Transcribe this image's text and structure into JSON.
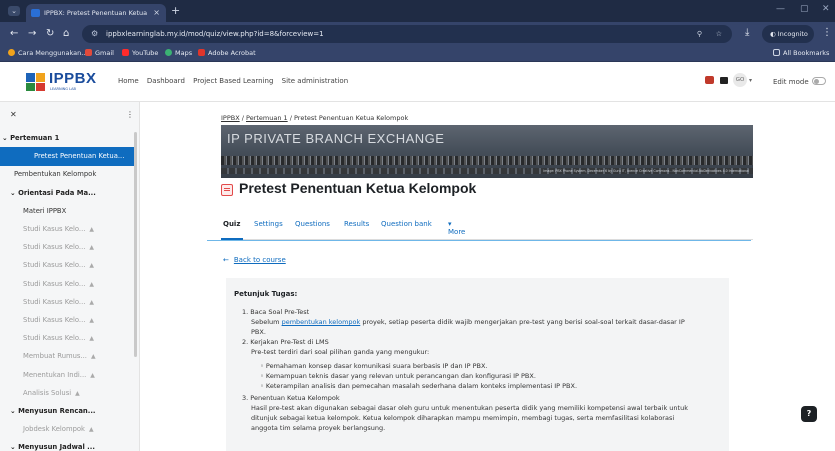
{
  "browser": {
    "tab_title": "IPPBX: Pretest Penentuan Ketua",
    "url": "ippbxlearninglab.my.id/mod/quiz/view.php?id=8&forceview=1",
    "incognito_label": "Incognito",
    "bookmarks": [
      "Cara Menggunakan...",
      "Gmail",
      "YouTube",
      "Maps",
      "Adobe Acrobat"
    ],
    "all_bookmarks": "All Bookmarks"
  },
  "header": {
    "logo_text": "IPPBX",
    "logo_sub": "LEARNING LAB",
    "nav": [
      "Home",
      "Dashboard",
      "Project Based Learning",
      "Site administration"
    ],
    "avatar_initials": "GO",
    "edit_mode": "Edit mode"
  },
  "sidebar": {
    "items": [
      {
        "label": "Pertemuan 1",
        "type": "section"
      },
      {
        "label": "Pretest Penentuan Ketua...",
        "type": "active"
      },
      {
        "label": "Pembentukan Kelompok",
        "type": "normal"
      },
      {
        "label": "Orientasi Pada Ma...",
        "type": "section"
      },
      {
        "label": "Materi IPPBX",
        "type": "normal"
      },
      {
        "label": "Studi Kasus Kelo...",
        "type": "muted"
      },
      {
        "label": "Studi Kasus Kelo...",
        "type": "muted"
      },
      {
        "label": "Studi Kasus Kelo...",
        "type": "muted"
      },
      {
        "label": "Studi Kasus Kelo...",
        "type": "muted"
      },
      {
        "label": "Studi Kasus Kelo...",
        "type": "muted"
      },
      {
        "label": "Studi Kasus Kelo...",
        "type": "muted"
      },
      {
        "label": "Studi Kasus Kelo...",
        "type": "muted"
      },
      {
        "label": "Membuat Rumus...",
        "type": "muted"
      },
      {
        "label": "Menentukan Indi...",
        "type": "muted"
      },
      {
        "label": "Analisis Solusi",
        "type": "muted"
      },
      {
        "label": "Menyusun Rencan...",
        "type": "section"
      },
      {
        "label": "Jobdesk Kelompok",
        "type": "muted"
      },
      {
        "label": "Menyusun Jadwal ...",
        "type": "section"
      }
    ]
  },
  "main": {
    "breadcrumb": [
      "IPPBX",
      "Pertemuan 1",
      "Pretest Penentuan Ketua Kelompok"
    ],
    "banner_title": "IP PRIVATE BRANCH EXCHANGE",
    "banner_credit": "Image: PBX Phone System, December 6 by Guru IT, licence Creative Commons - NonCommercial-NoDerivatives 4.0 International",
    "page_title": "Pretest Penentuan Ketua Kelompok",
    "tabs": [
      "Quiz",
      "Settings",
      "Questions",
      "Results",
      "Question bank",
      "More"
    ],
    "back_link": "Back to course",
    "card": {
      "heading": "Petunjuk Tugas:",
      "l1": "1. Baca Soal Pre-Test",
      "l1a_pre": "Sebelum ",
      "l1a_link": "pembentukan kelompok",
      "l1a_post": " proyek, setiap peserta didik wajib mengerjakan pre-test yang berisi soal-soal terkait dasar-dasar IP",
      "l1b": "PBX.",
      "l2": "2. Kerjakan Pre-Test di LMS",
      "l2a": "Pre-test terdiri dari soal pilihan ganda yang mengukur:",
      "b1": "Pemahaman konsep dasar komunikasi suara berbasis IP dan IP PBX.",
      "b2": "Kemampuan teknis dasar yang relevan untuk perancangan dan konfigurasi IP PBX.",
      "b3": "Keterampilan analisis dan pemecahan masalah sederhana dalam konteks implementasi IP PBX.",
      "l3": "3. Penentuan Ketua Kelompok",
      "l3a": "Hasil pre-test akan digunakan sebagai dasar oleh guru untuk menentukan peserta didik yang memiliki kompetensi awal terbaik untuk",
      "l3b": "ditunjuk sebagai ketua kelompok. Ketua kelompok diharapkan mampu memimpin, membagi tugas, serta memfasilitasi kolaborasi",
      "l3c": "anggota tim selama proyek berlangsung."
    },
    "help": "?"
  }
}
